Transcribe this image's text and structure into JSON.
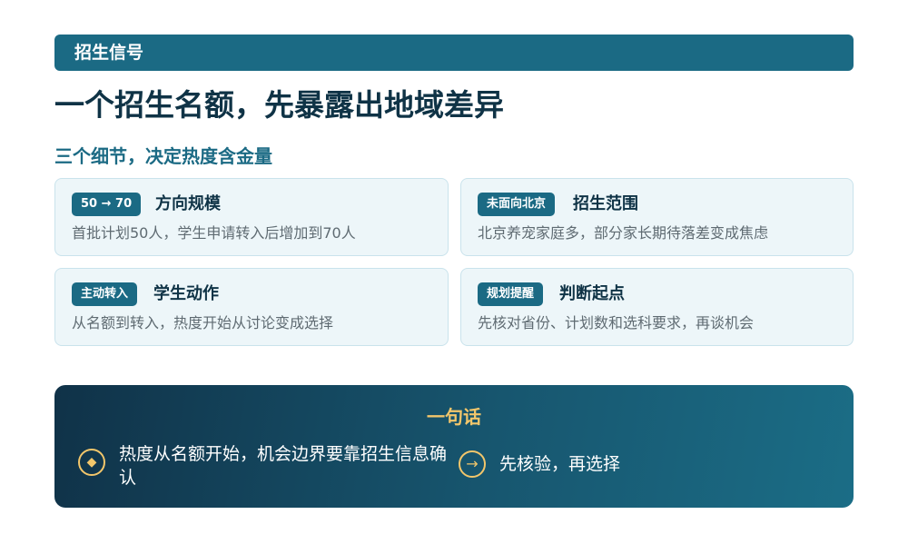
{
  "banner": {
    "label": "招生信号"
  },
  "headline": "一个招生名额，先暴露出地域差异",
  "subheading": "三个细节，决定热度含金量",
  "cards": [
    {
      "tag": "50 → 70",
      "title": "方向规模",
      "desc": "首批计划50人，学生申请转入后增加到70人"
    },
    {
      "tag": "未面向北京",
      "title": "招生范围",
      "desc": "北京养宠家庭多，部分家长期待落差变成焦虑"
    },
    {
      "tag": "主动转入",
      "title": "学生动作",
      "desc": "从名额到转入，热度开始从讨论变成选择"
    },
    {
      "tag": "规划提醒",
      "title": "判断起点",
      "desc": "先核对省份、计划数和选科要求，再谈机会"
    }
  ],
  "summary": {
    "title": "一句话",
    "points": [
      {
        "icon": "diamond-icon",
        "glyph": "◆",
        "text": "热度从名额开始，机会边界要靠招生信息确认"
      },
      {
        "icon": "arrow-right-icon",
        "glyph": "→",
        "text": "先核验，再选择"
      }
    ]
  },
  "colors": {
    "primary": "#1b6a84",
    "heading": "#0f3346",
    "accent_gold": "#f2c66b",
    "card_bg": "#edf6f9"
  }
}
